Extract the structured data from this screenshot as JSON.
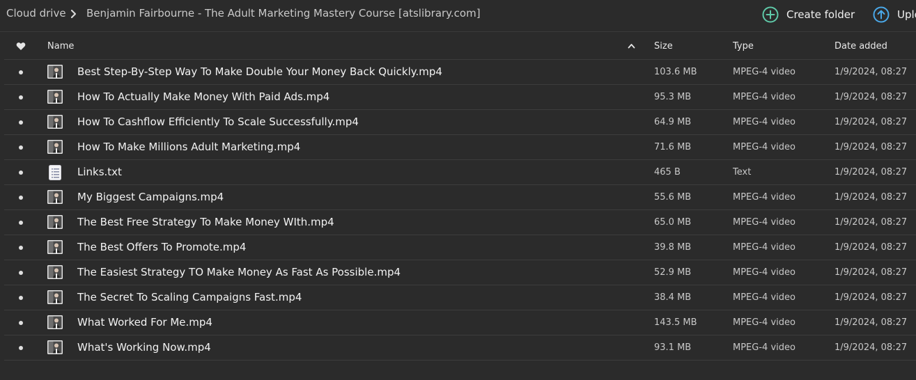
{
  "breadcrumb": {
    "root": "Cloud drive",
    "current": "Benjamin Fairbourne - The Adult Marketing Mastery Course [atslibrary.com]"
  },
  "actions": {
    "create_folder": "Create folder",
    "upload": "Upload"
  },
  "columns": {
    "name": "Name",
    "size": "Size",
    "type": "Type",
    "date": "Date added"
  },
  "files": [
    {
      "name": "Best Step-By-Step Way To Make Double Your Money Back Quickly.mp4",
      "size": "103.6 MB",
      "type": "MPEG-4 video",
      "date": "1/9/2024, 08:27",
      "icon": "video-thumbnail-icon"
    },
    {
      "name": "How To Actually Make Money With Paid Ads.mp4",
      "size": "95.3 MB",
      "type": "MPEG-4 video",
      "date": "1/9/2024, 08:27",
      "icon": "video-thumbnail-icon"
    },
    {
      "name": "How To Cashflow Efficiently To Scale Successfully.mp4",
      "size": "64.9 MB",
      "type": "MPEG-4 video",
      "date": "1/9/2024, 08:27",
      "icon": "video-thumbnail-icon"
    },
    {
      "name": "How To Make Millions Adult Marketing.mp4",
      "size": "71.6 MB",
      "type": "MPEG-4 video",
      "date": "1/9/2024, 08:27",
      "icon": "video-thumbnail-icon"
    },
    {
      "name": "Links.txt",
      "size": "465 B",
      "type": "Text",
      "date": "1/9/2024, 08:27",
      "icon": "text-file-icon"
    },
    {
      "name": "My Biggest Campaigns.mp4",
      "size": "55.6 MB",
      "type": "MPEG-4 video",
      "date": "1/9/2024, 08:27",
      "icon": "video-thumbnail-icon"
    },
    {
      "name": "The Best Free Strategy To Make Money WIth.mp4",
      "size": "65.0 MB",
      "type": "MPEG-4 video",
      "date": "1/9/2024, 08:27",
      "icon": "video-thumbnail-icon"
    },
    {
      "name": "The Best Offers To Promote.mp4",
      "size": "39.8 MB",
      "type": "MPEG-4 video",
      "date": "1/9/2024, 08:27",
      "icon": "video-thumbnail-icon"
    },
    {
      "name": "The Easiest Strategy TO Make Money As Fast As Possible.mp4",
      "size": "52.9 MB",
      "type": "MPEG-4 video",
      "date": "1/9/2024, 08:27",
      "icon": "video-thumbnail-icon"
    },
    {
      "name": "The Secret To Scaling Campaigns Fast.mp4",
      "size": "38.4 MB",
      "type": "MPEG-4 video",
      "date": "1/9/2024, 08:27",
      "icon": "video-thumbnail-icon"
    },
    {
      "name": "What Worked For Me.mp4",
      "size": "143.5 MB",
      "type": "MPEG-4 video",
      "date": "1/9/2024, 08:27",
      "icon": "video-thumbnail-icon"
    },
    {
      "name": "What's Working Now.mp4",
      "size": "93.1 MB",
      "type": "MPEG-4 video",
      "date": "1/9/2024, 08:27",
      "icon": "video-thumbnail-icon"
    }
  ],
  "colors": {
    "background": "#2b2b2b",
    "accent": "#5fc9a8",
    "upload_accent": "#4aa8e8"
  }
}
